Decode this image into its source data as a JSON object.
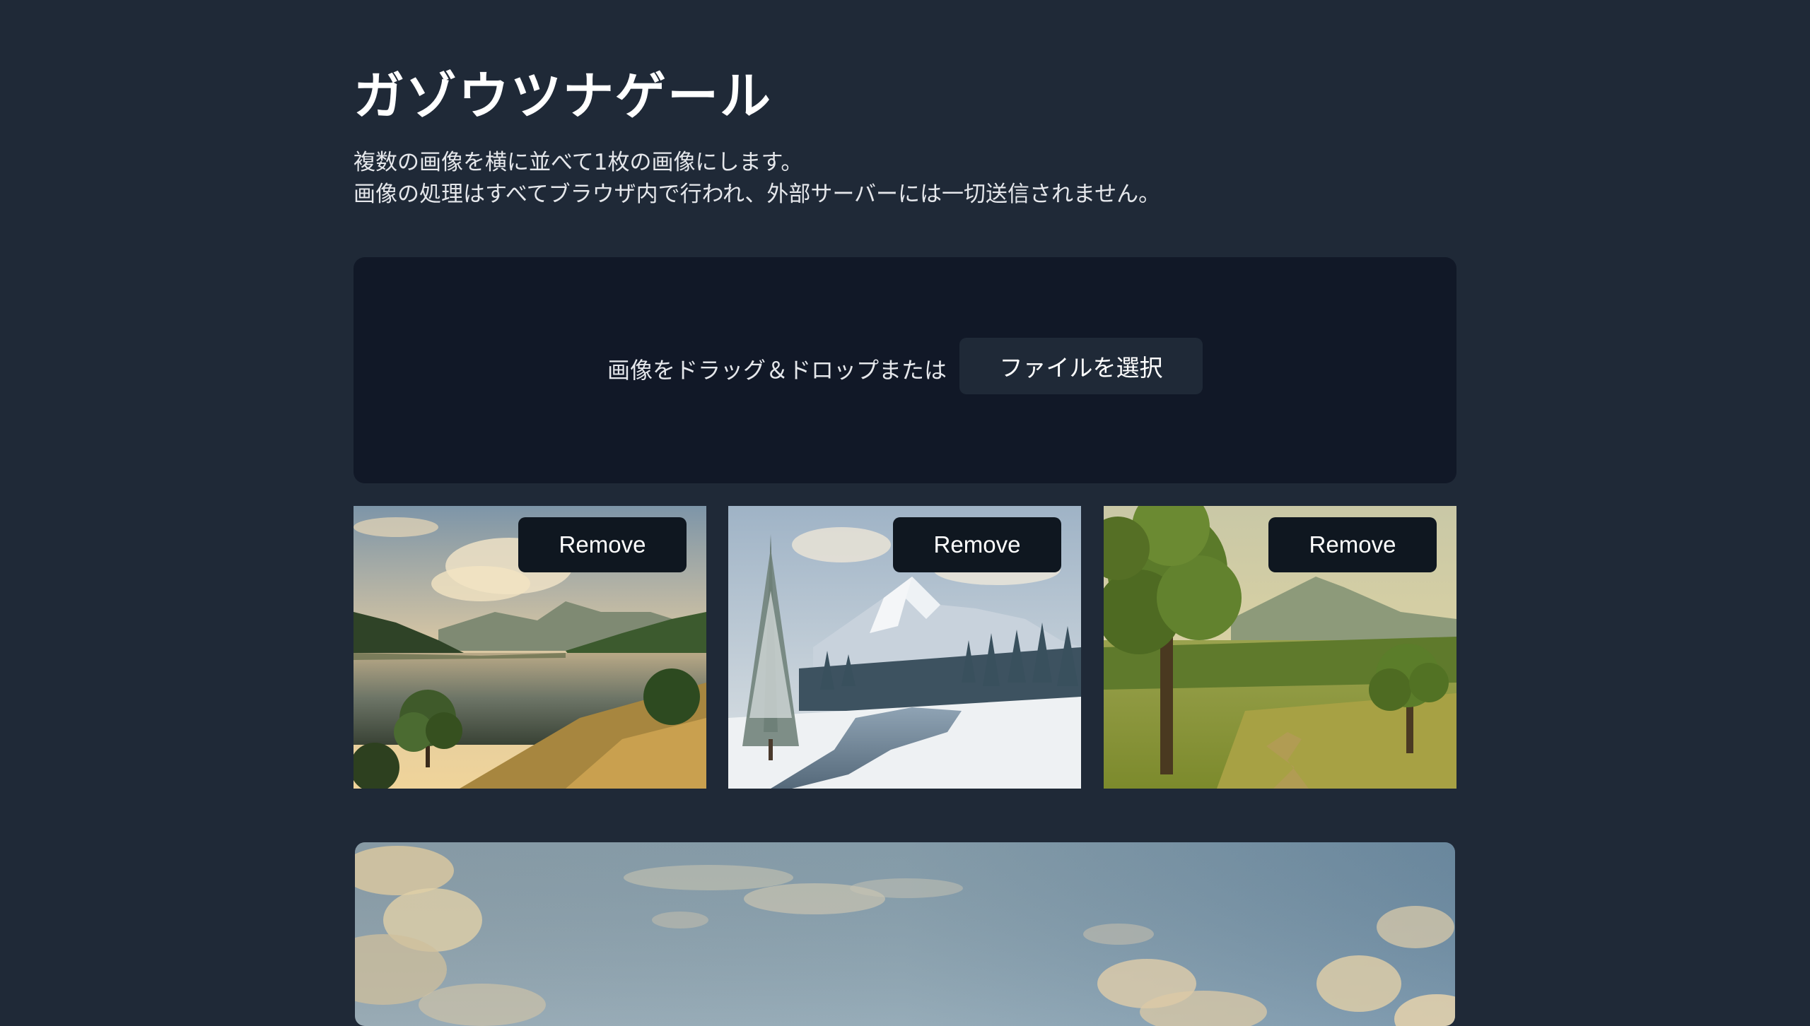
{
  "header": {
    "title": "ガゾウツナゲール",
    "description_line1": "複数の画像を横に並べて1枚の画像にします。",
    "description_line2": "画像の処理はすべてブラウザ内で行われ、外部サーバーには一切送信されません。"
  },
  "dropzone": {
    "text": "画像をドラッグ＆ドロップまたは",
    "button_label": "ファイルを選択"
  },
  "thumbnails": [
    {
      "scene": "lake-landscape",
      "remove_label": "Remove"
    },
    {
      "scene": "snowy-mountain",
      "remove_label": "Remove"
    },
    {
      "scene": "green-meadow",
      "remove_label": "Remove"
    }
  ],
  "preview": {
    "scene": "sky-with-clouds"
  },
  "colors": {
    "background": "#1f2937",
    "dropzone": "#111827",
    "button": "#0f1720",
    "text": "#ffffff"
  }
}
